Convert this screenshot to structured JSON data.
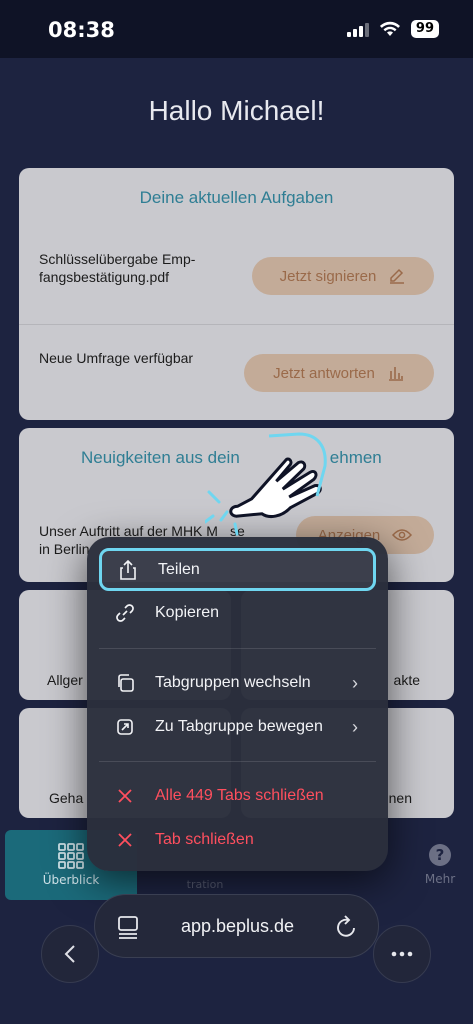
{
  "status": {
    "time": "08:38",
    "battery": "99"
  },
  "greeting": "Hallo Michael!",
  "tasks_card": {
    "title": "Deine aktuellen Aufgaben",
    "items": [
      {
        "text_line1": "Schlüsselübergabe Emp-",
        "text_line2": "fangsbestätigung.pdf",
        "button": "Jetzt signieren",
        "icon": "pencil-icon"
      },
      {
        "text_line1": "Neue Umfrage verfügbar",
        "text_line2": "",
        "button": "Jetzt antworten",
        "icon": "bar-chart-icon"
      }
    ]
  },
  "news_card": {
    "title": "Neuigkeiten aus dein",
    "title_end": "ehmen",
    "item_line1": "Unser Auftritt auf der MHK M",
    "item_line1_end": "se",
    "item_line2": "in Berlin",
    "button": "Anzeigen"
  },
  "tiles": {
    "left_top": "Allger",
    "right_top": "akte",
    "left_bottom": "Geha",
    "right_bottom": "nen"
  },
  "tabbar": {
    "active_label": "Überblick",
    "faded_middle": "tration",
    "mehr": "Mehr"
  },
  "menu": {
    "items": [
      {
        "label": "Teilen",
        "icon": "share-icon"
      },
      {
        "label": "Kopieren",
        "icon": "link-icon"
      },
      {
        "label": "Tabgruppen wechseln",
        "icon": "tab-groups-icon",
        "chevron": "›"
      },
      {
        "label": "Zu Tabgruppe bewegen",
        "icon": "move-to-group-icon",
        "chevron": "›"
      },
      {
        "label": "Alle 449 Tabs schließen",
        "icon": "close-icon"
      },
      {
        "label": "Tab schließen",
        "icon": "close-icon"
      }
    ]
  },
  "urlbar": {
    "url": "app.beplus.de"
  },
  "colors": {
    "accent": "#6fd6f0",
    "destructive": "#ff4f5e",
    "brand_teal": "#1b6a7a"
  }
}
